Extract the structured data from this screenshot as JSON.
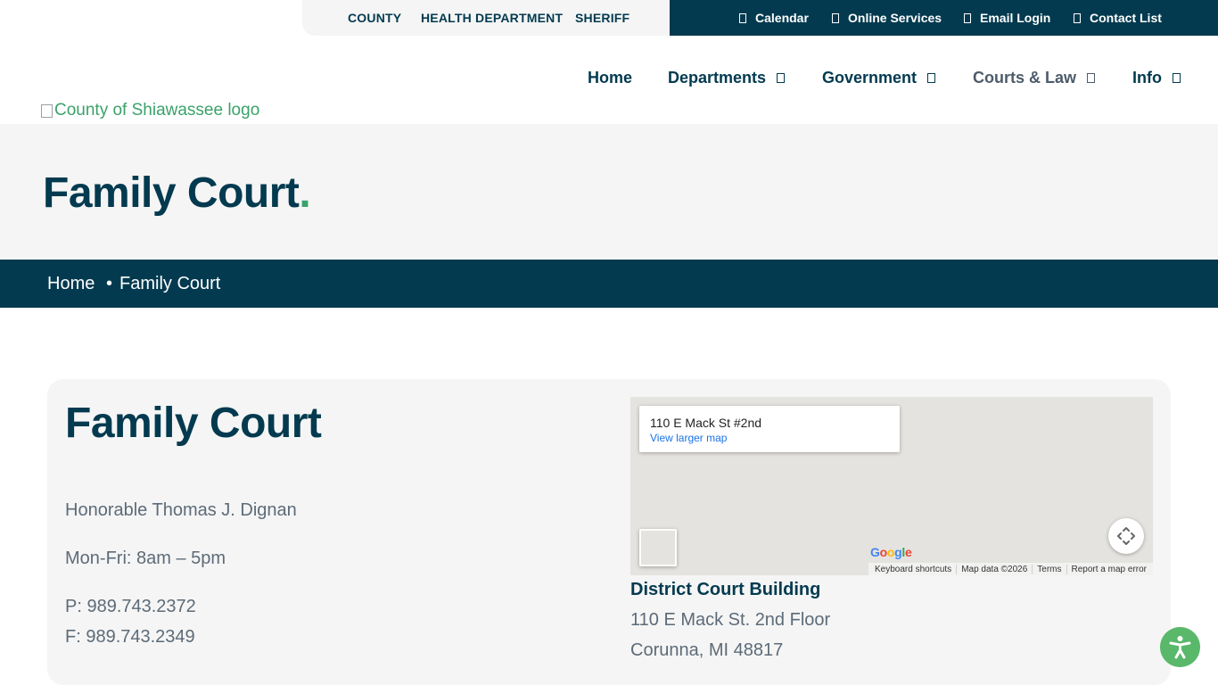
{
  "topbar": {
    "left_links": [
      "COUNTY",
      "HEALTH DEPARTMENT",
      "SHERIFF"
    ],
    "right_links": [
      {
        "label": "Calendar",
        "icon": "calendar-icon"
      },
      {
        "label": "Online Services",
        "icon": "services-icon"
      },
      {
        "label": "Email Login",
        "icon": "email-icon"
      },
      {
        "label": "Contact List",
        "icon": "contact-icon"
      }
    ]
  },
  "nav": {
    "items": [
      "Home",
      "Departments",
      "Government",
      "Courts & Law",
      "Info"
    ],
    "active": "Courts & Law"
  },
  "logo": {
    "alt": "County of Shiawassee logo"
  },
  "hero": {
    "title": "Family Court",
    "title_dot": "."
  },
  "breadcrumb": {
    "home": "Home",
    "separator": "•",
    "current": "Family Court"
  },
  "card": {
    "title": "Family Court",
    "judge": "Honorable Thomas J. Dignan",
    "hours": "Mon-Fri: 8am – 5pm",
    "phone": "P: 989.743.2372",
    "fax": "F: 989.743.2349"
  },
  "map": {
    "address": "110 E Mack St #2nd",
    "larger_link": "View larger map",
    "logo_text": "Google",
    "footer": [
      "Keyboard shortcuts",
      "Map data ©2026",
      "Terms",
      "Report a map error"
    ]
  },
  "location": {
    "building": "District Court Building",
    "line1": "110 E Mack St. 2nd Floor",
    "line2": "Corunna, MI 48817"
  },
  "colors": {
    "navy": "#033a4f",
    "green": "#3aa26a",
    "panel": "#f5f5f5",
    "text_gray": "#5d6b78",
    "accessibility": "#59b86a"
  }
}
